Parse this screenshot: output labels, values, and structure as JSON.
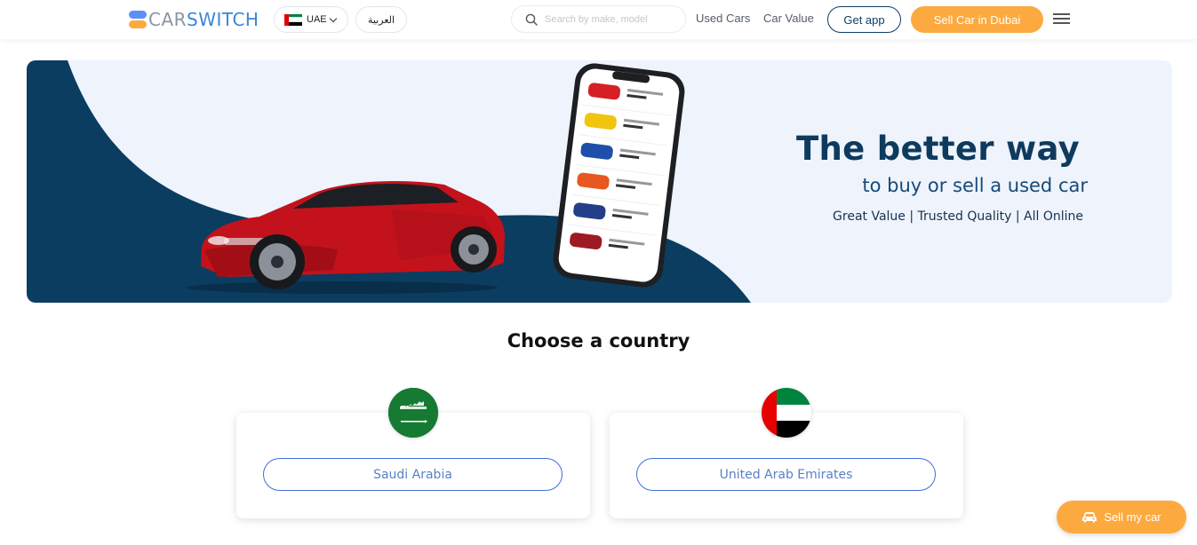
{
  "header": {
    "logo": {
      "part1": "CAR",
      "part2": "SWITCH"
    },
    "country_code": "UAE",
    "language_toggle": "العربية",
    "search": {
      "placeholder": "Search by make, model",
      "value": ""
    },
    "nav": {
      "used_cars": "Used Cars",
      "car_value": "Car Value"
    },
    "get_app": "Get app",
    "sell_cta": "Sell Car in Dubai"
  },
  "hero": {
    "title": "The better way",
    "subtitle": "to buy or sell a used car",
    "tagline": "Great Value | Trusted Quality | All Online"
  },
  "country_section": {
    "title": "Choose a country",
    "countries": [
      {
        "name": "Saudi Arabia",
        "flag_icon": "saudi-flag-icon"
      },
      {
        "name": "United Arab Emirates",
        "flag_icon": "uae-flag-icon"
      }
    ]
  },
  "floating_cta": {
    "label": "Sell my car",
    "icon": "car-icon"
  },
  "colors": {
    "brand_blue": "#3b86d8",
    "brand_orange": "#fcaa3f",
    "navy": "#0e3a5e",
    "hero_bg": "#eef3fc",
    "link_blue": "#3e6fd8"
  }
}
